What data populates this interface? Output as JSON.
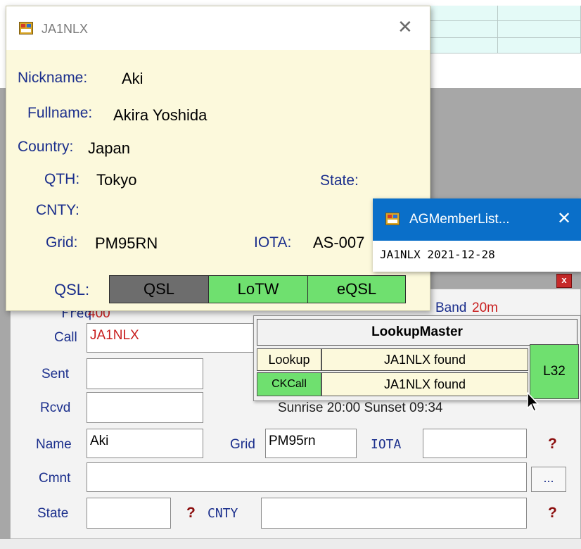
{
  "info_popup": {
    "title": "JA1NLX",
    "nickname_label": "Nickname:",
    "nickname": "Aki",
    "fullname_label": "Fullname:",
    "fullname": "Akira Yoshida",
    "country_label": "Country:",
    "country": "Japan",
    "qth_label": "QTH:",
    "qth": "Tokyo",
    "state_label": "State:",
    "cnty_label": "CNTY:",
    "grid_label": "Grid:",
    "grid": "PM95RN",
    "iota_label": "IOTA:",
    "iota": "AS-007",
    "qsl_label": "QSL:",
    "qsl_buttons": [
      {
        "label": "QSL",
        "color": "#6d6d6d"
      },
      {
        "label": "LoTW",
        "color": "#6fe06f"
      },
      {
        "label": "eQSL",
        "color": "#6fe06f"
      }
    ]
  },
  "ag_window": {
    "title": "AGMemberList...",
    "entry": "JA1NLX  2021-12-28"
  },
  "lookup": {
    "title": "LookupMaster",
    "rows": [
      {
        "label": "Lookup",
        "result": "JA1NLX found"
      },
      {
        "label": "CKCall",
        "result": "JA1NLX found"
      }
    ],
    "level": "L32"
  },
  "entry_form": {
    "freq_label": "Freq",
    "freq_value": "400",
    "band_label": "Band",
    "band_value": "20m",
    "call_label": "Call",
    "call_value": "JA1NLX",
    "sent_label": "Sent",
    "sent_value": "",
    "rcvd_label": "Rcvd",
    "rcvd_value": "",
    "sun_text": "Sunrise 20:00 Sunset 09:34",
    "name_label": "Name",
    "name_value": "Aki",
    "grid_label": "Grid",
    "grid_value": "PM95rn",
    "iota_label": "IOTA",
    "iota_value": "",
    "cmnt_label": "Cmnt",
    "cmnt_value": "",
    "more_button": "...",
    "state_label": "State",
    "state_value": "",
    "cnty_label": "CNTY",
    "cnty_value": "",
    "help_mark": "?",
    "close_mark": "x"
  },
  "colors": {
    "label_blue": "#1a2e8c",
    "call_red": "#c81e1e",
    "popup_bg": "#fcf9dc",
    "qsl_green": "#6fe06f",
    "titlebar_blue": "#0a6fc9"
  }
}
